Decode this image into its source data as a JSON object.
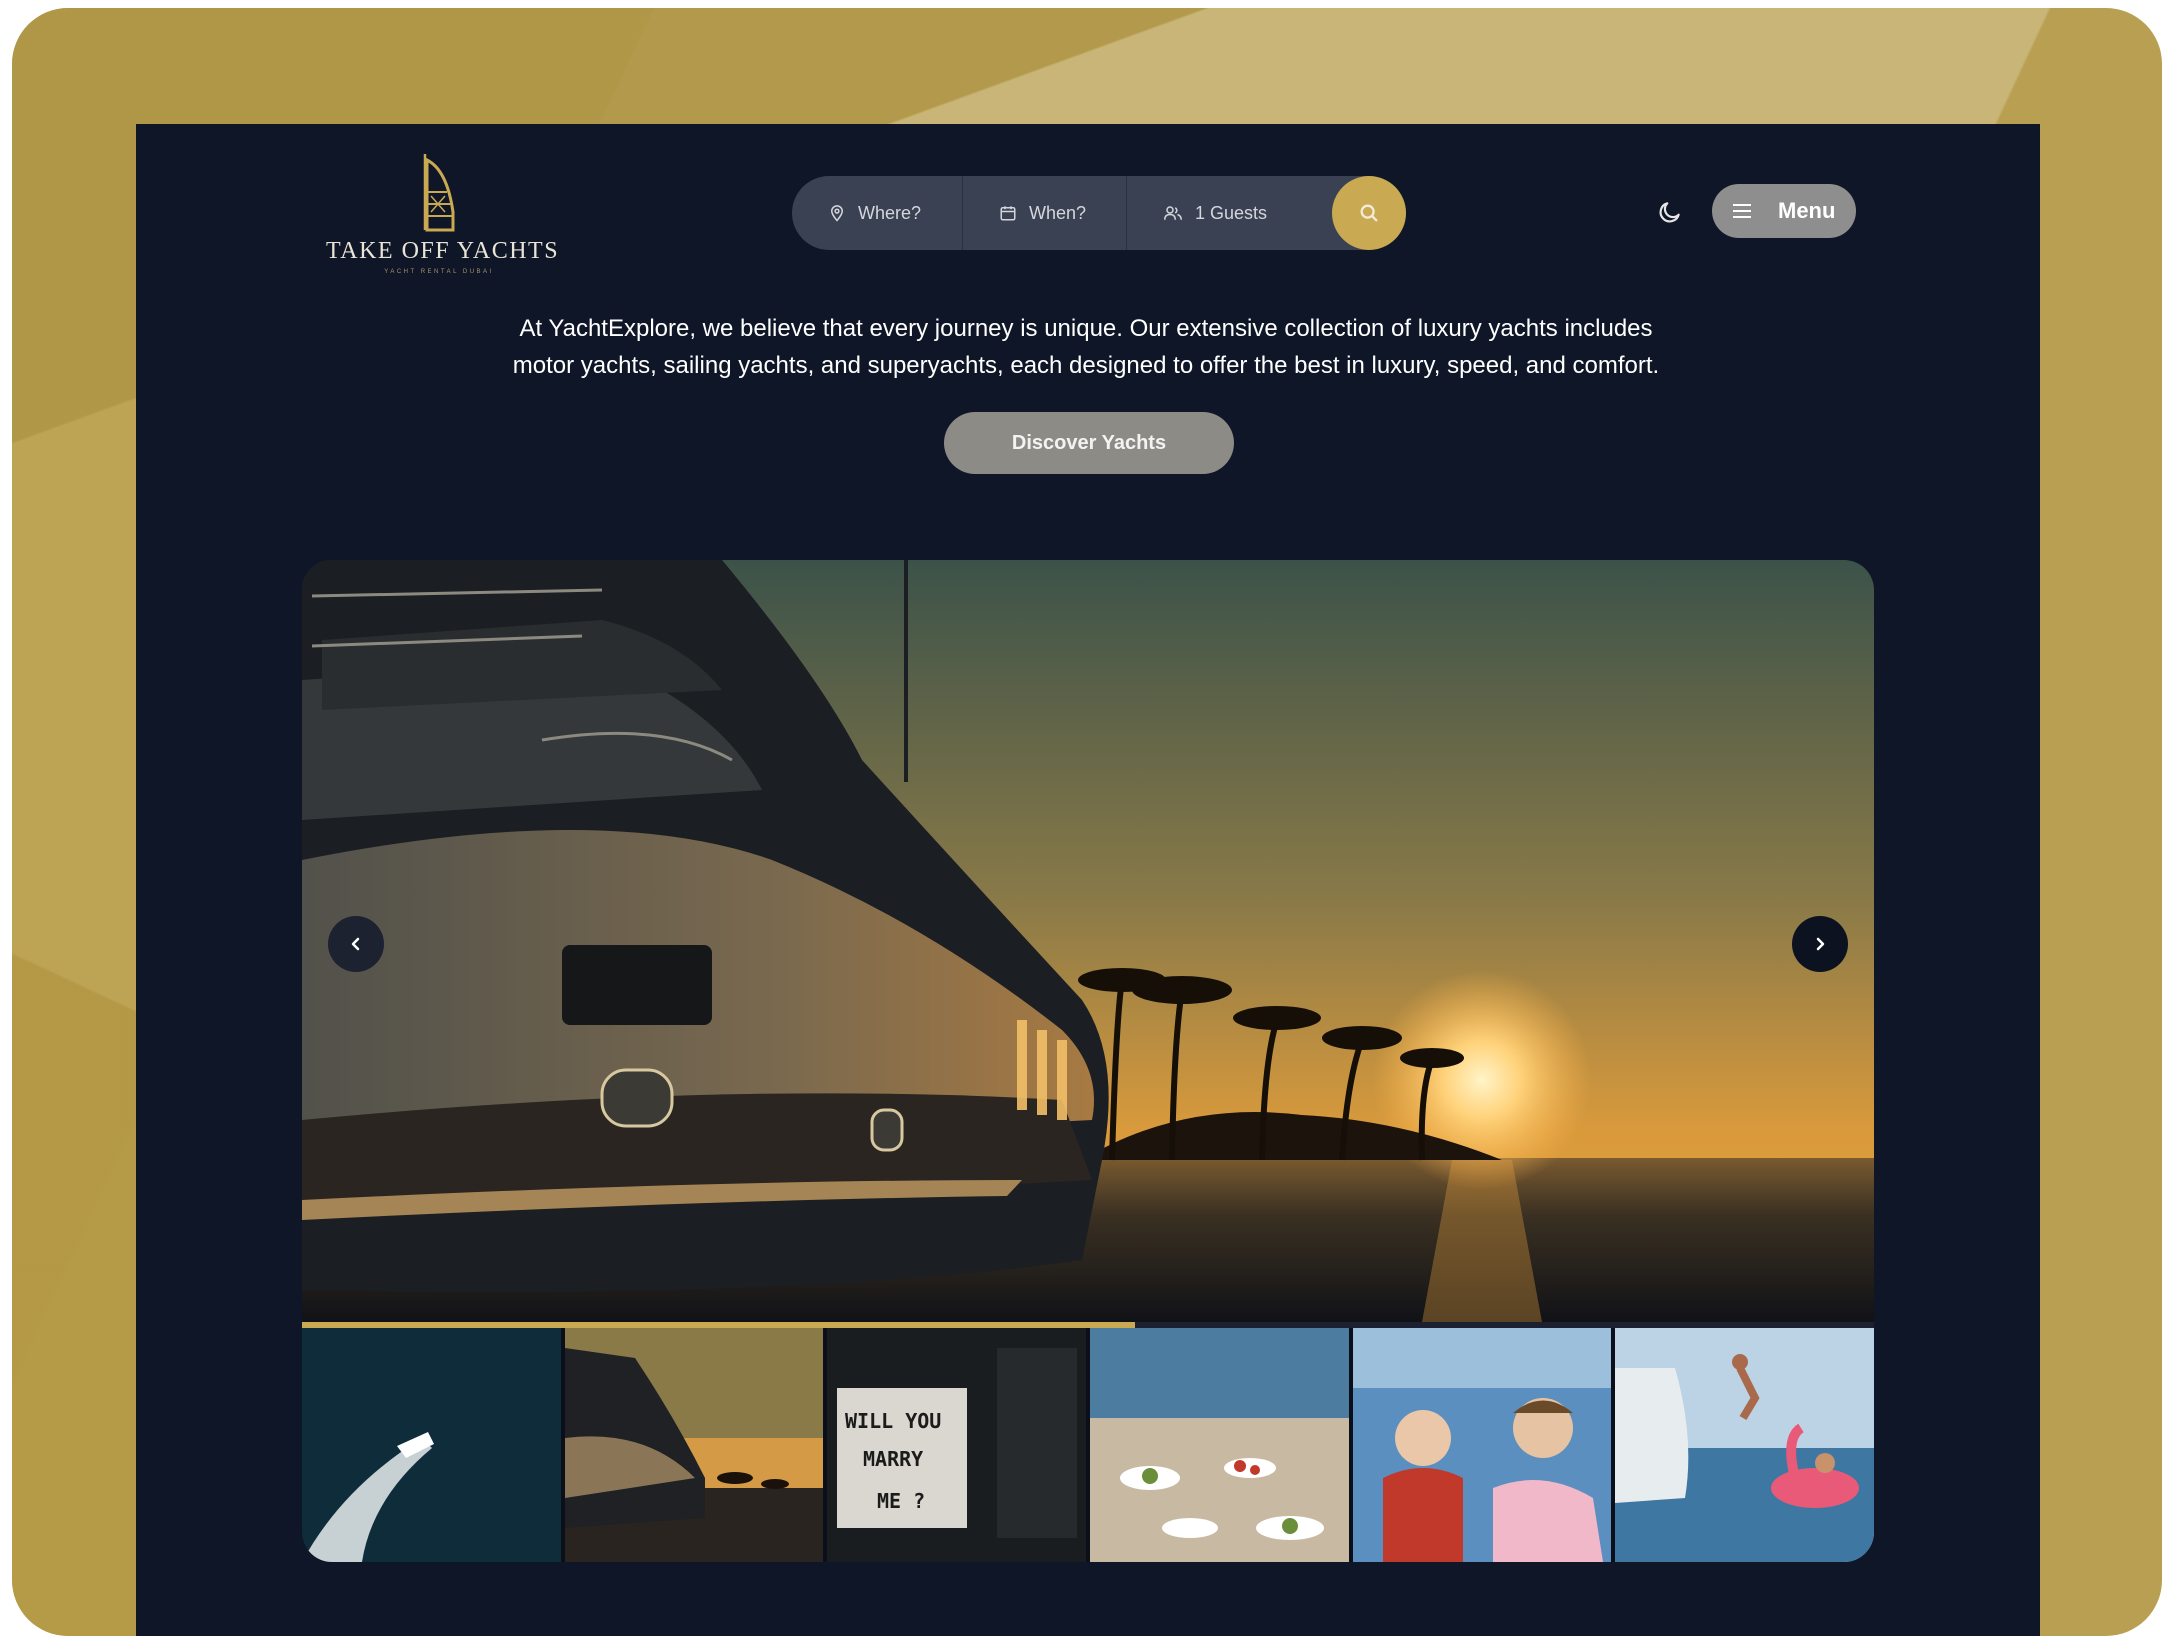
{
  "brand": {
    "name": "TAKE OFF YACHTS",
    "tagline": "YACHT RENTAL DUBAI"
  },
  "search": {
    "where_label": "Where?",
    "when_label": "When?",
    "guests_label": "1 Guests"
  },
  "header": {
    "menu_label": "Menu"
  },
  "intro": {
    "line1": "At YachtExplore, we believe that every journey is unique. Our extensive collection of luxury yachts includes",
    "line2": "motor yachts, sailing yachts, and superyachts, each designed to offer the best in luxury, speed, and comfort."
  },
  "cta": {
    "discover_label": "Discover Yachts"
  },
  "slider": {
    "progress": 0.53,
    "thumbnails": [
      {
        "subject": "speedboat-wake"
      },
      {
        "subject": "yacht-sunset"
      },
      {
        "subject": "marry-me-lightbox",
        "text": [
          "WILL YOU",
          "MARRY",
          "ME ?"
        ]
      },
      {
        "subject": "dining-table"
      },
      {
        "subject": "kids-on-boat"
      },
      {
        "subject": "flamingo-float"
      }
    ]
  },
  "colors": {
    "accent_gold": "#c9aa52",
    "background_dark": "#0f1627",
    "frame_gold": "#c9b577"
  },
  "icons": [
    "logo-tower-icon",
    "map-pin-icon",
    "calendar-icon",
    "guests-icon",
    "search-icon",
    "moon-icon",
    "hamburger-icon",
    "chevron-left-icon",
    "chevron-right-icon"
  ]
}
